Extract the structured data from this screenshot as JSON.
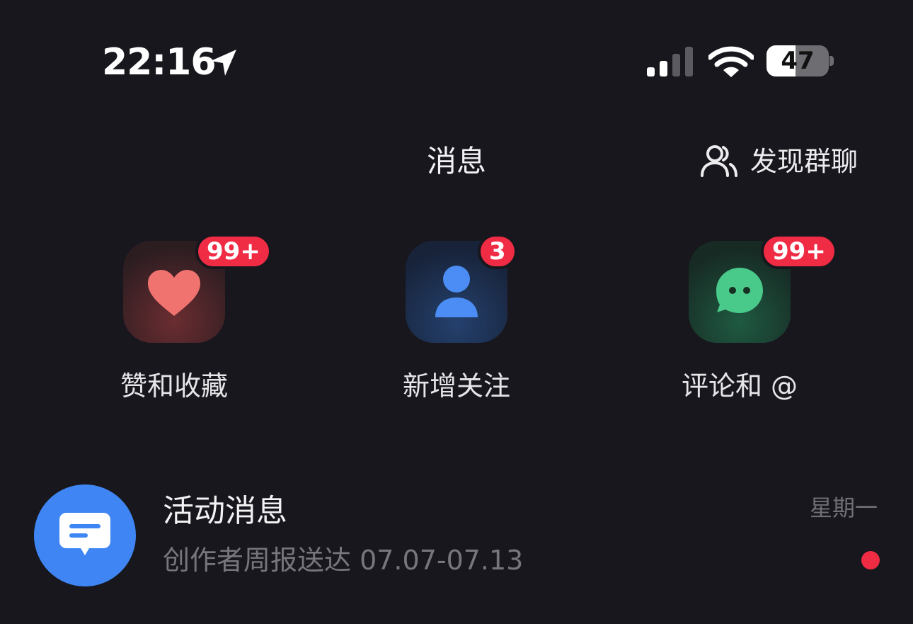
{
  "status_bar": {
    "time": "22:16",
    "battery_level": "47",
    "battery_fraction": 0.47
  },
  "header": {
    "title": "消息",
    "discover_label": "发现群聊",
    "discover_icon": "people-icon"
  },
  "entries": [
    {
      "label": "赞和收藏",
      "badge": "99+",
      "icon": "heart-icon",
      "accent": "#f0736f"
    },
    {
      "label": "新增关注",
      "badge": "3",
      "icon": "person-icon",
      "accent": "#4b8df4"
    },
    {
      "label": "评论和 @",
      "badge": "99+",
      "icon": "chat-bubble-icon",
      "accent": "#49c98a"
    }
  ],
  "messages": [
    {
      "title": "活动消息",
      "subtitle": "创作者周报送达 07.07-07.13",
      "time": "星期一",
      "icon": "message-icon",
      "unread": true
    }
  ],
  "colors": {
    "background": "#17171d",
    "badge": "#f02b44",
    "avatar": "#3f86f4"
  }
}
